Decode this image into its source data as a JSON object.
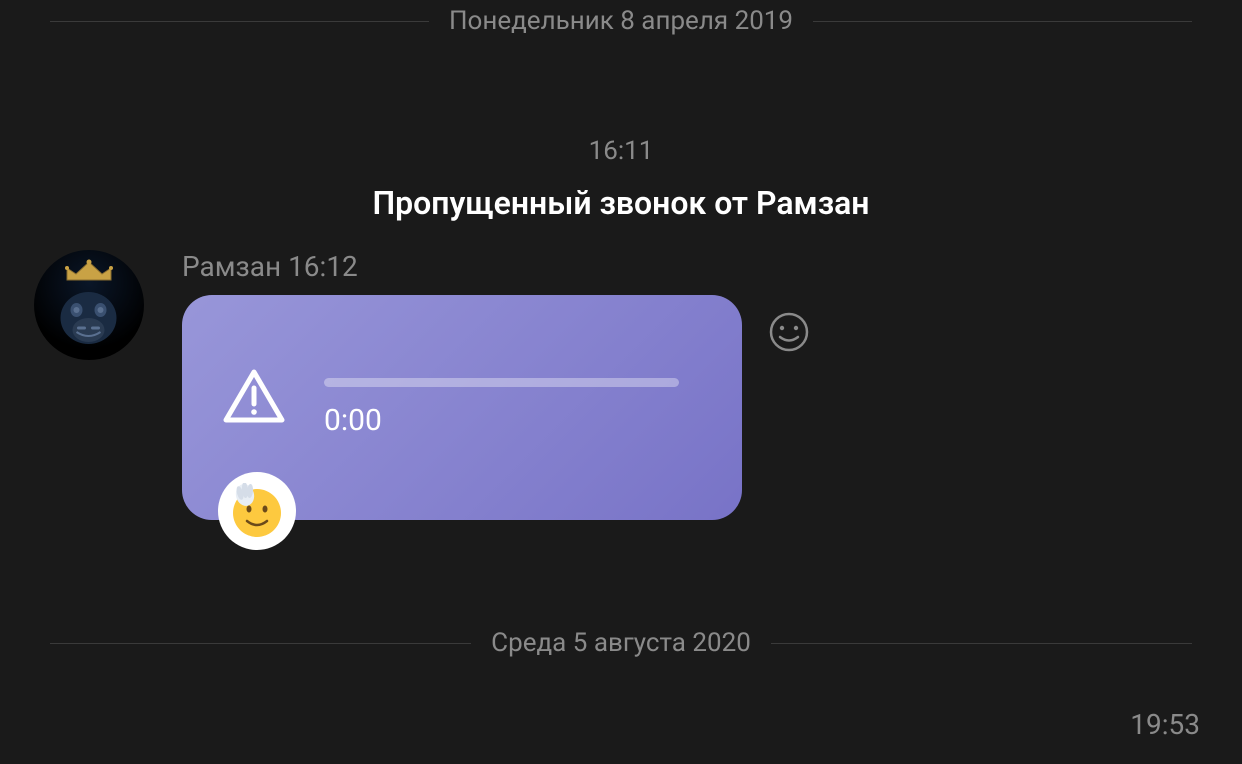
{
  "date_dividers": {
    "first": "Понедельник 8 апреля 2019",
    "second": "Среда 5 августа 2020"
  },
  "missed_call": {
    "time": "16:11",
    "text": "Пропущенный звонок от Рамзан"
  },
  "message": {
    "sender": "Рамзан",
    "time": "16:12",
    "duration": "0:00"
  },
  "bottom_time": "19:53"
}
